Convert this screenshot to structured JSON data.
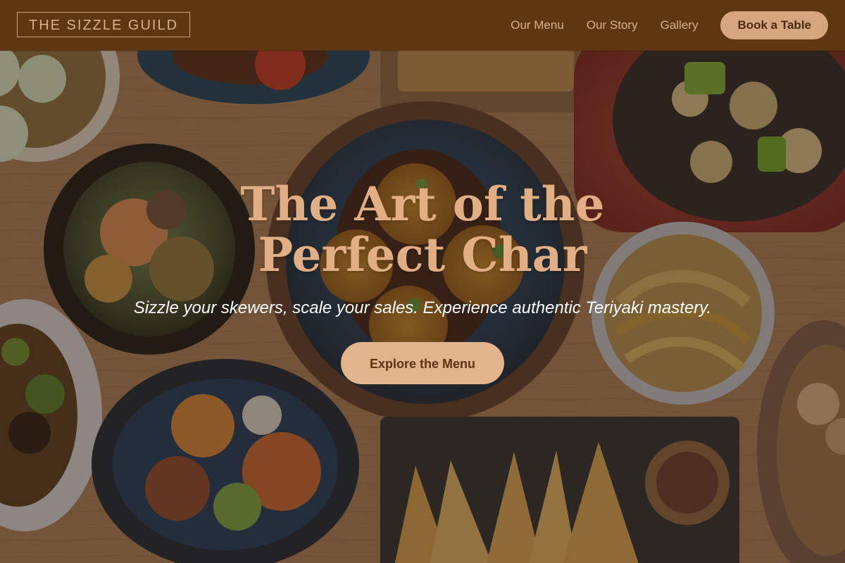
{
  "header": {
    "logo": "THE SIZZLE GUILD",
    "nav_links": [
      "Our Menu",
      "Our Story",
      "Gallery"
    ],
    "cta_label": "Book a Table"
  },
  "hero": {
    "title": "The Art of the Perfect Char",
    "subtitle": "Sizzle your skewers, scale your sales. Experience authentic Teriyaki mastery.",
    "button_label": "Explore the Menu"
  },
  "background": {
    "image_content": "overhead view of various Asian dishes on a wooden table"
  },
  "colors": {
    "header_bg": "#5c3710",
    "accent": "#e2ae83",
    "button_bg": "#e2b48d",
    "button_text": "#5a3414"
  }
}
